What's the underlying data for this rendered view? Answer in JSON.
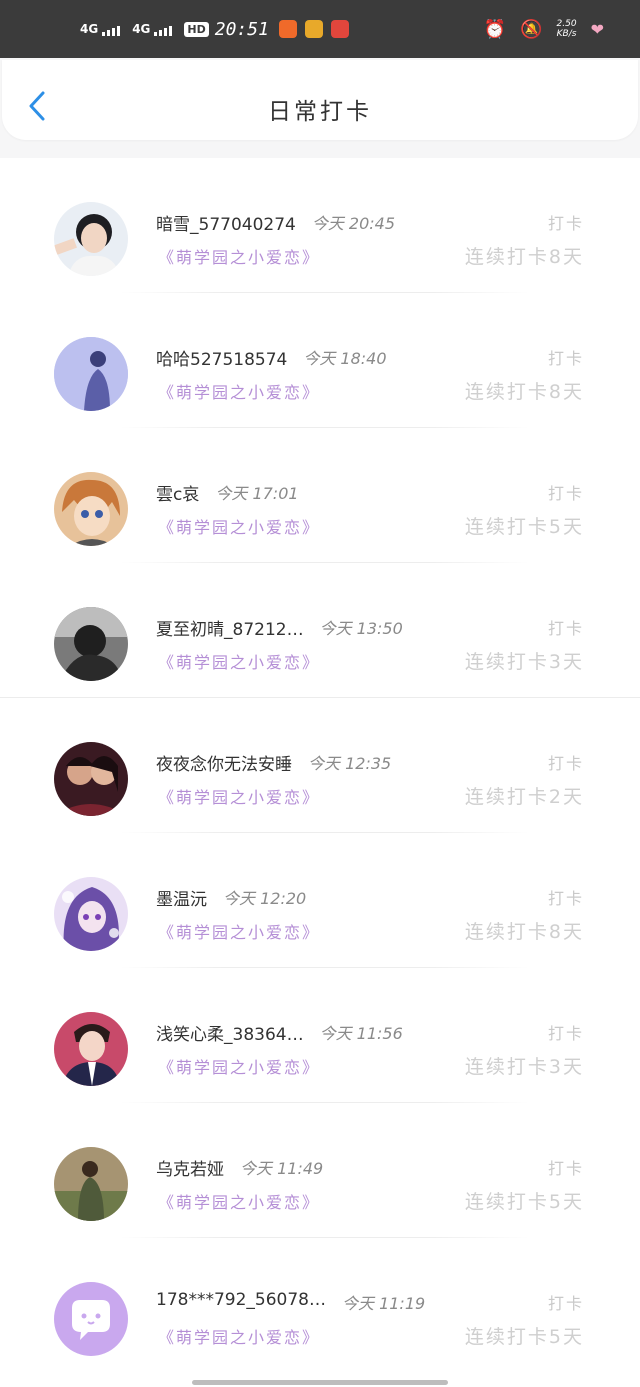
{
  "status_bar": {
    "sig1": "4G",
    "sig2": "4G",
    "hd": "HD",
    "time": "20:51",
    "speed_value": "2.50",
    "speed_unit": "KB/s"
  },
  "header": {
    "title": "日常打卡"
  },
  "list": {
    "items": [
      {
        "name": "暗雪_577040274",
        "time": "今天 20:45",
        "book": "《萌学园之小爱恋》",
        "action": "打卡",
        "streak": "连续打卡8天"
      },
      {
        "name": "哈哈527518574",
        "time": "今天 18:40",
        "book": "《萌学园之小爱恋》",
        "action": "打卡",
        "streak": "连续打卡8天"
      },
      {
        "name": "雲ᴄ哀",
        "time": "今天 17:01",
        "book": "《萌学园之小爱恋》",
        "action": "打卡",
        "streak": "连续打卡5天"
      },
      {
        "name": "夏至初晴_87212…",
        "time": "今天 13:50",
        "book": "《萌学园之小爱恋》",
        "action": "打卡",
        "streak": "连续打卡3天"
      },
      {
        "name": "夜夜念你无法安睡",
        "time": "今天 12:35",
        "book": "《萌学园之小爱恋》",
        "action": "打卡",
        "streak": "连续打卡2天"
      },
      {
        "name": "墨温沅",
        "time": "今天 12:20",
        "book": "《萌学园之小爱恋》",
        "action": "打卡",
        "streak": "连续打卡8天"
      },
      {
        "name": "浅笑心柔_38364…",
        "time": "今天 11:56",
        "book": "《萌学园之小爱恋》",
        "action": "打卡",
        "streak": "连续打卡3天"
      },
      {
        "name": "乌克若娅",
        "time": "今天 11:49",
        "book": "《萌学园之小爱恋》",
        "action": "打卡",
        "streak": "连续打卡5天"
      },
      {
        "name": "178***792_56078…",
        "time": "今天 11:19",
        "book": "《萌学园之小爱恋》",
        "action": "打卡",
        "streak": "连续打卡5天"
      }
    ]
  },
  "colors": {
    "accent_blue": "#2d8fe6",
    "book_purple": "#b58fd6"
  }
}
